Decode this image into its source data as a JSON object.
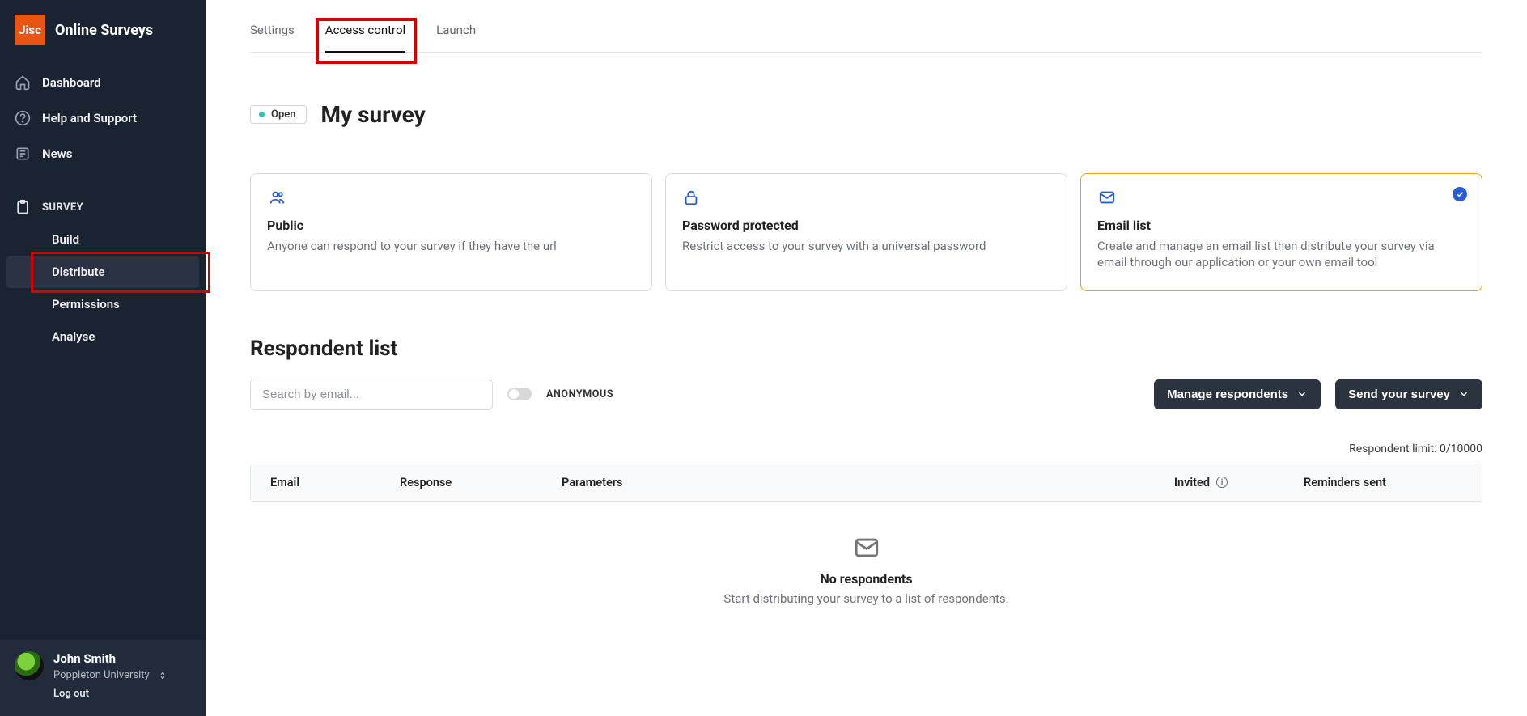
{
  "brand": {
    "logo_text": "Jisc",
    "name": "Online Surveys"
  },
  "nav": {
    "dashboard": "Dashboard",
    "help": "Help and Support",
    "news": "News"
  },
  "survey_section": {
    "label": "SURVEY",
    "build": "Build",
    "distribute": "Distribute",
    "permissions": "Permissions",
    "analyse": "Analyse"
  },
  "account": {
    "name": "John Smith",
    "org": "Poppleton University",
    "logout": "Log out"
  },
  "tabs": {
    "settings": "Settings",
    "access_control": "Access control",
    "launch": "Launch"
  },
  "page": {
    "status": "Open",
    "title": "My survey"
  },
  "cards": {
    "public": {
      "title": "Public",
      "desc": "Anyone can respond to your survey if they have the url"
    },
    "password": {
      "title": "Password protected",
      "desc": "Restrict access to your survey with a universal password"
    },
    "email": {
      "title": "Email list",
      "desc": "Create and manage an email list then distribute your survey via email through our application or your own email tool"
    }
  },
  "respondents": {
    "section_title": "Respondent list",
    "search_placeholder": "Search by email...",
    "anonymous_label": "ANONYMOUS",
    "manage_btn": "Manage respondents",
    "send_btn": "Send your survey",
    "limit_label": "Respondent limit: 0/10000",
    "columns": {
      "email": "Email",
      "response": "Response",
      "parameters": "Parameters",
      "invited": "Invited",
      "reminders": "Reminders sent"
    },
    "empty_title": "No respondents",
    "empty_desc": "Start distributing your survey to a list of respondents."
  }
}
